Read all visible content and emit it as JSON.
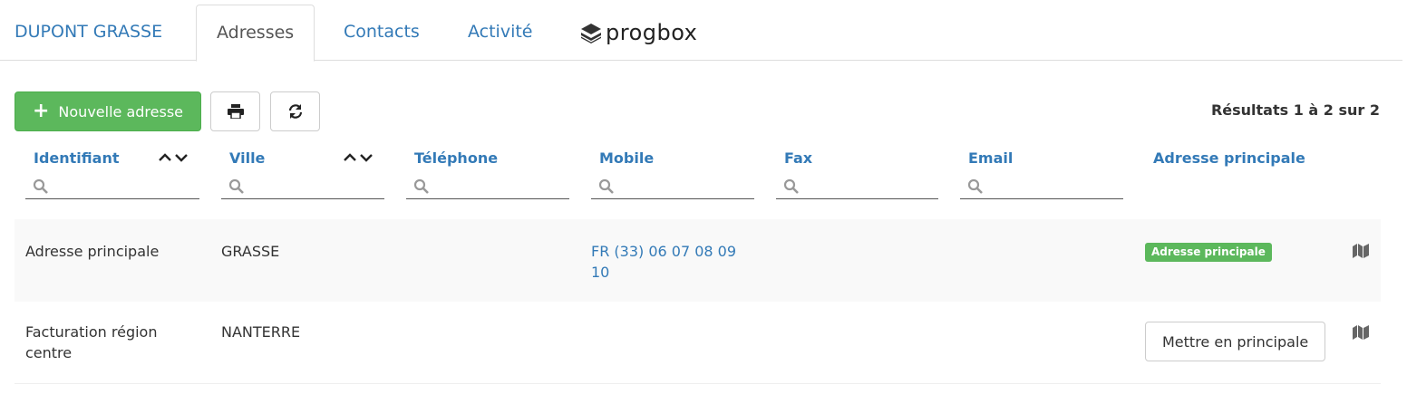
{
  "tabs": {
    "client": "DUPONT GRASSE",
    "adresses": "Adresses",
    "contacts": "Contacts",
    "activite": "Activité",
    "logo_text": "progbox"
  },
  "toolbar": {
    "new_label": "Nouvelle adresse",
    "new_icon": "plus-icon",
    "print_icon": "print-icon",
    "refresh_icon": "refresh-icon",
    "results": "Résultats 1 à 2 sur 2"
  },
  "columns": {
    "identifiant": "Identifiant",
    "ville": "Ville",
    "telephone": "Téléphone",
    "mobile": "Mobile",
    "fax": "Fax",
    "email": "Email",
    "principale": "Adresse principale"
  },
  "rows": [
    {
      "identifiant": "Adresse principale",
      "ville": "GRASSE",
      "telephone": "",
      "mobile": "FR (33) 06 07 08 09 10",
      "fax": "",
      "email": "",
      "principale_badge": "Adresse principale"
    },
    {
      "identifiant": "Facturation région centre",
      "ville": "NANTERRE",
      "telephone": "",
      "mobile": "",
      "fax": "",
      "email": "",
      "principale_button": "Mettre en principale"
    }
  ],
  "colors": {
    "link": "#337ab7",
    "success": "#5cb85c",
    "row_alt": "#f9f9f9"
  }
}
